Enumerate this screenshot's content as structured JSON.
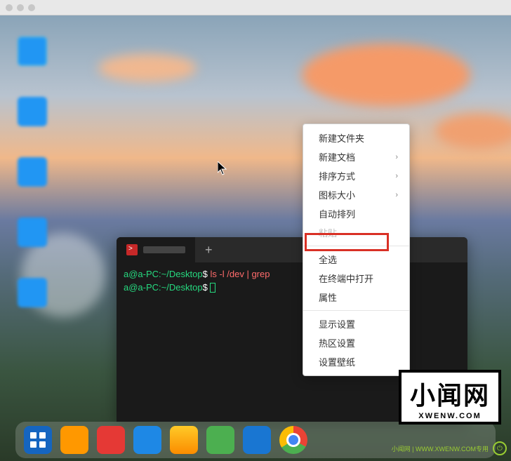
{
  "contextMenu": {
    "items": [
      {
        "label": "新建文件夹",
        "hasSubmenu": false,
        "disabled": false
      },
      {
        "label": "新建文档",
        "hasSubmenu": true,
        "disabled": false
      },
      {
        "label": "排序方式",
        "hasSubmenu": true,
        "disabled": false
      },
      {
        "label": "图标大小",
        "hasSubmenu": true,
        "disabled": false
      },
      {
        "label": "自动排列",
        "hasSubmenu": false,
        "disabled": false
      },
      {
        "label": "粘贴",
        "hasSubmenu": false,
        "disabled": true
      }
    ],
    "group2": [
      {
        "label": "全选",
        "disabled": false
      },
      {
        "label": "在终端中打开",
        "disabled": false,
        "highlighted": true
      },
      {
        "label": "属性",
        "disabled": false
      }
    ],
    "group3": [
      {
        "label": "显示设置"
      },
      {
        "label": "热区设置"
      },
      {
        "label": "设置壁纸"
      }
    ]
  },
  "terminal": {
    "newTabGlyph": "+",
    "lines": [
      {
        "prompt": "a@a-PC",
        "path": "~/Desktop",
        "sep": ":",
        "dollar": "$",
        "cmd": "ls -l /dev | grep"
      },
      {
        "prompt": "a@a-PC",
        "path": "~/Desktop",
        "sep": ":",
        "dollar": "$",
        "cmd": ""
      }
    ]
  },
  "watermark": {
    "big": "小闻网",
    "small": "XWENW.COM"
  },
  "tray": {
    "text": "小闻网 | WWW.XWENW.COM专用"
  }
}
